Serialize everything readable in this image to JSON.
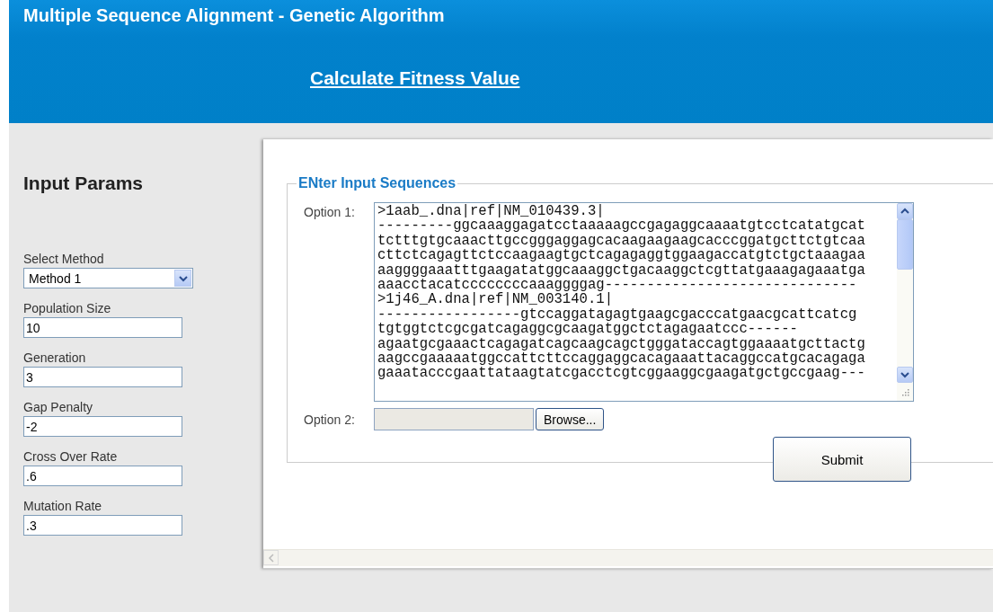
{
  "header": {
    "title": "Multiple Sequence Alignment - Genetic Algorithm",
    "link": "Calculate Fitness Value"
  },
  "sidebar": {
    "heading": "Input Params",
    "fields": [
      {
        "kind": "select",
        "label": "Select Method",
        "value": "Method 1"
      },
      {
        "kind": "text",
        "label": "Population Size",
        "value": "10"
      },
      {
        "kind": "text",
        "label": "Generation",
        "value": "3"
      },
      {
        "kind": "text",
        "label": "Gap Penalty",
        "value": "-2"
      },
      {
        "kind": "text",
        "label": "Cross Over Rate",
        "value": ".6"
      },
      {
        "kind": "text",
        "label": "Mutation Rate",
        "value": ".3"
      }
    ]
  },
  "form": {
    "legend": "ENter Input Sequences",
    "option_1": {
      "label": "Option 1:",
      "lines": [
        ">1aab_.dna|ref|NM_010439.3|",
        "---------ggcaaaggagatcctaaaaagccgagaggcaaaatgtcctcatatgcat",
        "tctttgtgcaaacttgccgggaggagcacaagaagaagcacccggatgcttctgtcaa",
        "cttctcagagttctccaagaagtgctcagagaggtggaagaccatgtctgctaaagaa",
        "aaggggaaatttgaagatatggcaaaggctgacaaggctcgttatgaaagagaaatga",
        "aaacctacatccccccccaaaggggag------------------------------",
        ">1j46_A.dna|ref|NM_003140.1|",
        "-----------------gtccaggatagagtgaagcgacccatgaacgcattcatcg",
        "tgtggtctcgcgatcagaggcgcaagatggctctagagaatccc------",
        "agaatgcgaaactcagagatcagcaagcagctgggataccagtggaaaatgcttactg",
        "aagccgaaaaatggccattcttccaggaggcacagaaattacaggccatgcacagaga",
        "gaaatacccgaattataagtatcgacctcgtcggaaggcgaagatgctgccgaag---"
      ]
    },
    "option_2": {
      "label": "Option 2:",
      "button": "Browse..."
    },
    "submit": "Submit"
  }
}
